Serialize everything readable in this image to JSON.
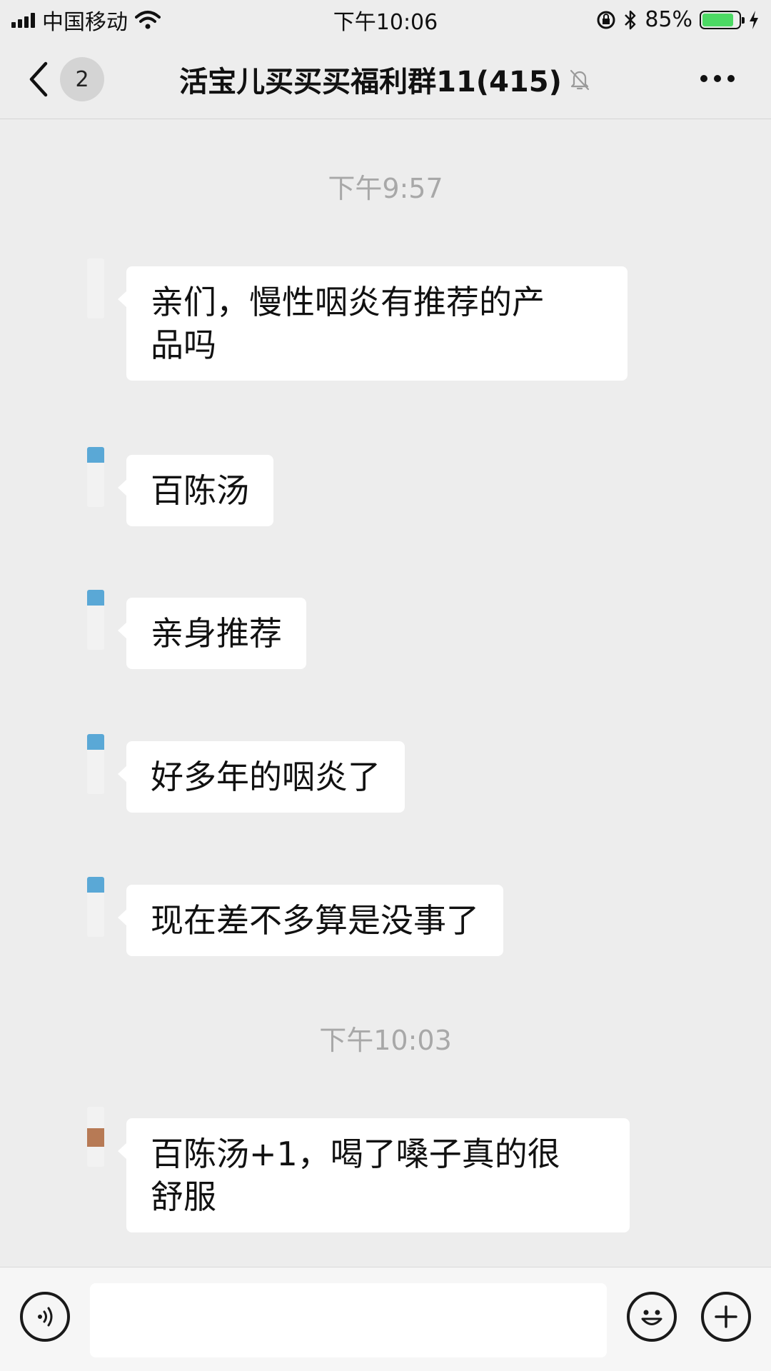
{
  "status_bar": {
    "carrier": "中国移动",
    "time": "下午10:06",
    "battery_percent": "85%",
    "battery_level": 0.85,
    "battery_color": "#4cd964",
    "icons": [
      "signal-bars-icon",
      "wifi-icon",
      "orientation-lock-icon",
      "bluetooth-icon",
      "battery-icon",
      "charging-bolt-icon"
    ]
  },
  "nav": {
    "back_icon": "chevron-left-icon",
    "unread_count": "2",
    "title": "活宝儿买买买福利群11(415)",
    "mute_icon": "bell-muted-icon",
    "more_icon": "more-dots-icon"
  },
  "chat": {
    "timestamps": [
      "下午9:57",
      "下午10:03"
    ],
    "messages": [
      {
        "text_lines": [
          "亲们，慢性咽炎有推荐的产",
          "品吗"
        ]
      },
      {
        "text_lines": [
          "百陈汤"
        ]
      },
      {
        "text_lines": [
          "亲身推荐"
        ]
      },
      {
        "text_lines": [
          "好多年的咽炎了"
        ]
      },
      {
        "text_lines": [
          "现在差不多算是没事了"
        ]
      },
      {
        "text_lines": [
          "百陈汤+1，喝了嗓子真的很",
          "舒服"
        ]
      }
    ]
  },
  "input_bar": {
    "voice_icon": "voice-icon",
    "message_value": "",
    "emoji_icon": "emoji-icon",
    "plus_icon": "plus-icon"
  }
}
